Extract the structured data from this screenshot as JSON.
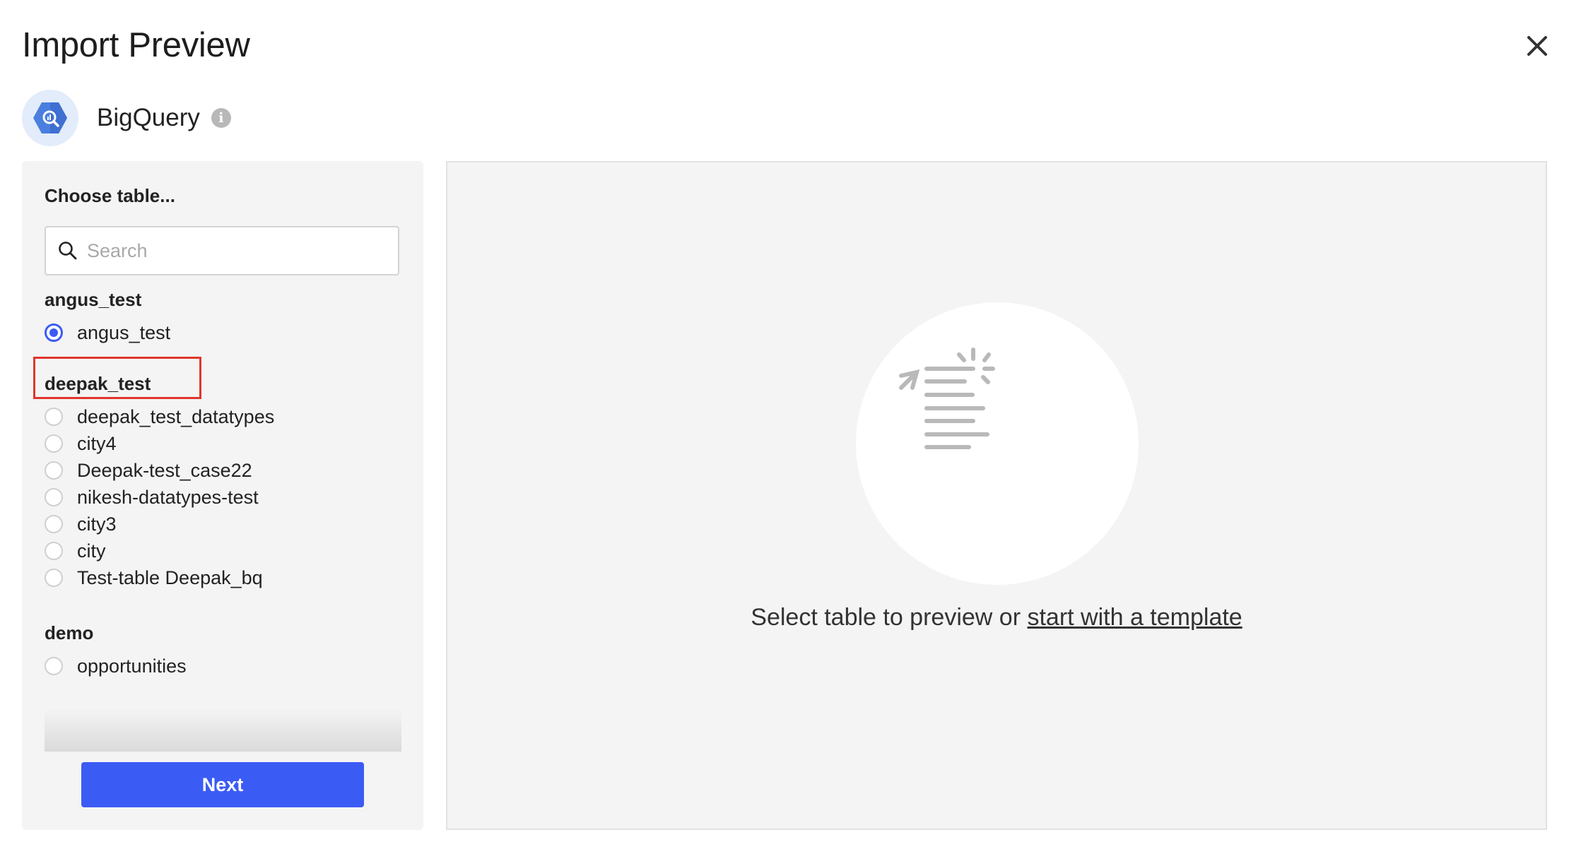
{
  "dialog": {
    "title": "Import Preview",
    "close_icon": "close-icon"
  },
  "source": {
    "name": "BigQuery",
    "logo_icon": "bigquery-logo-icon",
    "info_icon": "info-icon",
    "info_glyph": "i"
  },
  "left_panel": {
    "heading": "Choose table...",
    "search": {
      "placeholder": "Search",
      "value": "",
      "icon": "search-icon"
    },
    "groups": [
      {
        "name": "angus_test",
        "tables": [
          {
            "label": "angus_test",
            "selected": true
          }
        ]
      },
      {
        "name": "deepak_test",
        "tables": [
          {
            "label": "deepak_test_datatypes",
            "selected": false
          },
          {
            "label": "city4",
            "selected": false
          },
          {
            "label": "Deepak-test_case22",
            "selected": false
          },
          {
            "label": "nikesh-datatypes-test",
            "selected": false
          },
          {
            "label": "city3",
            "selected": false
          },
          {
            "label": "city",
            "selected": false
          },
          {
            "label": "Test-table Deepak_bq",
            "selected": false
          }
        ]
      },
      {
        "name": "demo",
        "tables": [
          {
            "label": "opportunities",
            "selected": false
          }
        ]
      }
    ],
    "next_button": "Next"
  },
  "right_panel": {
    "illustration_icon": "document-send-icon",
    "message_prefix": "Select table to preview or ",
    "template_link": "start with a template"
  },
  "colors": {
    "accent": "#3b5bf5",
    "highlight_outline": "#e0362c",
    "panel_bg": "#f4f4f4"
  }
}
